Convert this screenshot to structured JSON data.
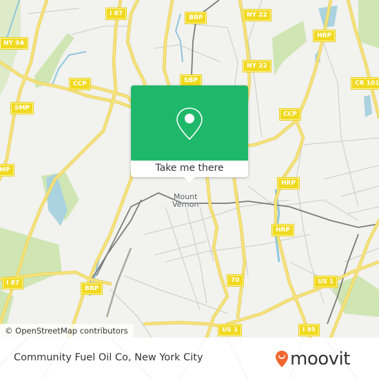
{
  "map": {
    "attribution": "© OpenStreetMap contributors",
    "place_labels": [
      {
        "id": "mount-vernon",
        "line1": "Mount",
        "line2": "Vernon"
      }
    ],
    "road_shields": [
      {
        "id": "i87-top",
        "label": "I 87"
      },
      {
        "id": "ny9a",
        "label": "NY 9A"
      },
      {
        "id": "ccp-left",
        "label": "CCP"
      },
      {
        "id": "smp",
        "label": "SMP"
      },
      {
        "id": "mp-left",
        "label": "MP"
      },
      {
        "id": "brp-top",
        "label": "BRP"
      },
      {
        "id": "ny22-top",
        "label": "NY 22"
      },
      {
        "id": "ny22-mid",
        "label": "NY 22"
      },
      {
        "id": "sbp",
        "label": "SBP"
      },
      {
        "id": "hrp-top",
        "label": "HRP"
      },
      {
        "id": "cr101",
        "label": "CR 101"
      },
      {
        "id": "ccp-right",
        "label": "CCP"
      },
      {
        "id": "hrp-mid",
        "label": "HRP"
      },
      {
        "id": "hrp-low",
        "label": "HRP"
      },
      {
        "id": "i87-bottom",
        "label": "I 87"
      },
      {
        "id": "brp-bottom",
        "label": "BRP"
      },
      {
        "id": "route70",
        "label": "70"
      },
      {
        "id": "us1-right",
        "label": "US 1"
      },
      {
        "id": "us1-bottom",
        "label": "US 1"
      },
      {
        "id": "i95",
        "label": "I 95"
      }
    ],
    "colors": {
      "background": "#f2f2ee",
      "major_road": "#f5e27a",
      "road_shield": "#f1d91f",
      "water": "#aad3df",
      "park": "#cde8b0",
      "rail": "#7a7a7a",
      "minor_road": "#c8c8c4"
    }
  },
  "popup": {
    "icon": "map-pin-icon",
    "button_label": "Take me there",
    "color": "#1fb86a"
  },
  "footer": {
    "title": "Community Fuel Oil Co, New York City",
    "logo_text": "moovit",
    "logo_icon": "moovit-pin-smile-icon",
    "logo_color": "#f2662f"
  }
}
